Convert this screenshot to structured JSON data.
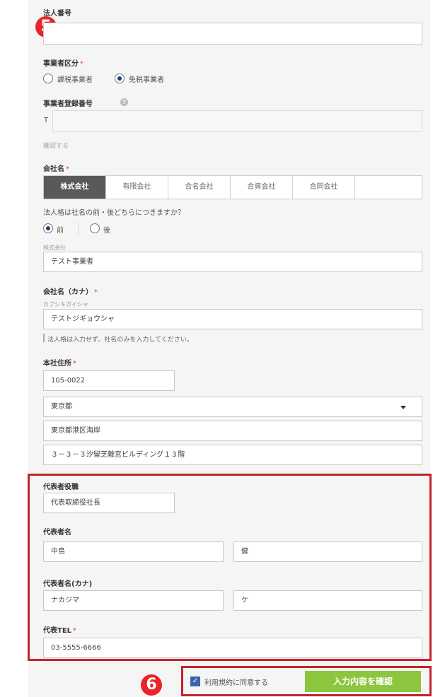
{
  "required_mark": "*",
  "badges": {
    "step5": "5",
    "step6": "6"
  },
  "corporate_number": {
    "label": "法人番号",
    "value": ""
  },
  "business_type": {
    "label": "事業者区分",
    "options": [
      "課税事業者",
      "免税事業者"
    ],
    "selected": "免税事業者"
  },
  "registration_number": {
    "label": "事業者登録番号",
    "help_glyph": "?",
    "prefix": "T",
    "value": "",
    "verify_link": "確認する"
  },
  "company_name": {
    "label": "会社名",
    "types": [
      "株式会社",
      "有限会社",
      "合名会社",
      "合資会社",
      "合同会社"
    ],
    "selected_type": "株式会社",
    "position_question": "法人格は社名の前・後どちらにつきますか？",
    "position_options": [
      "前",
      "後"
    ],
    "position_selected": "前",
    "prefix_preview": "株式会社",
    "value": "テスト事業者"
  },
  "company_kana": {
    "label": "会社名（カナ）",
    "placeholder": "カブシキガイシャ",
    "value": "テストジギョウシャ",
    "hint": "法人格は入力せず、社名のみを入力してください。"
  },
  "address": {
    "label": "本社住所",
    "postal_code": "105-0022",
    "prefecture": "東京都",
    "city": "東京都港区海岸",
    "building": "３－３－３汐留芝離宮ビルディング１３階"
  },
  "representative": {
    "title_label": "代表者役職",
    "title_value": "代表取締役社長",
    "name_label": "代表者名",
    "last_name": "中島",
    "first_name": "健",
    "kana_label": "代表者名(カナ)",
    "last_kana": "ナカジマ",
    "first_kana": "ケ",
    "tel_label": "代表TEL",
    "tel": "03-5555-6666"
  },
  "footer": {
    "check_glyph": "✓",
    "agree_label": "利用規約に同意する",
    "agree_checked": true,
    "confirm_button": "入力内容を確認"
  },
  "colors": {
    "accent_red": "#e8252a",
    "highlight_border": "#c4232a",
    "confirm_button": "#8cc63f",
    "checkbox": "#3b64b0",
    "selected_segment": "#595959"
  }
}
